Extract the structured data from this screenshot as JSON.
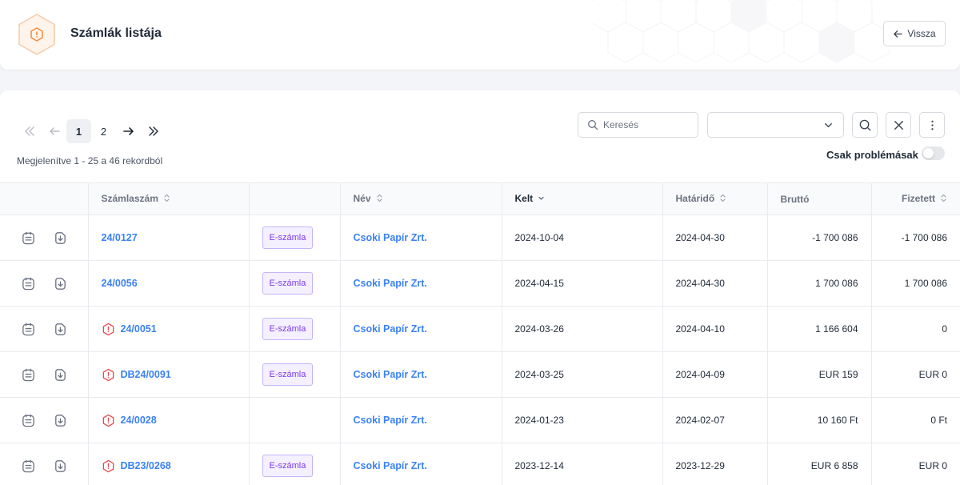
{
  "header": {
    "title": "Számlák listája",
    "back_label": "Vissza"
  },
  "pagination": {
    "pages": [
      "1",
      "2"
    ],
    "current": "1",
    "records_text": "Megjelenítve 1 - 25 a 46 rekordból"
  },
  "filters": {
    "search_placeholder": "Keresés",
    "select_value": "",
    "toggle_label": "Csak problémásak",
    "toggle_on": false
  },
  "table": {
    "columns": [
      "",
      "Számlaszám",
      "",
      "Név",
      "Kelt",
      "Határidő",
      "Bruttó",
      "Fizetett"
    ],
    "rows": [
      {
        "invoice": "24/0127",
        "warning": false,
        "badge": "E-számla",
        "name": "Csoki Papír Zrt.",
        "issued": "2024-10-04",
        "due": "2024-04-30",
        "gross": "-1 700 086",
        "paid": "-1 700 086"
      },
      {
        "invoice": "24/0056",
        "warning": false,
        "badge": "E-számla",
        "name": "Csoki Papír Zrt.",
        "issued": "2024-04-15",
        "due": "2024-04-30",
        "gross": "1 700 086",
        "paid": "1 700 086"
      },
      {
        "invoice": "24/0051",
        "warning": true,
        "badge": "E-számla",
        "name": "Csoki Papír Zrt.",
        "issued": "2024-03-26",
        "due": "2024-04-10",
        "gross": "1 166 604",
        "paid": "0"
      },
      {
        "invoice": "DB24/0091",
        "warning": true,
        "badge": "E-számla",
        "name": "Csoki Papír Zrt.",
        "issued": "2024-03-25",
        "due": "2024-04-09",
        "gross": "EUR 159",
        "paid": "EUR 0"
      },
      {
        "invoice": "24/0028",
        "warning": true,
        "badge": "",
        "name": "Csoki Papír Zrt.",
        "issued": "2024-01-23",
        "due": "2024-02-07",
        "gross": "10 160 Ft",
        "paid": "0 Ft"
      },
      {
        "invoice": "DB23/0268",
        "warning": true,
        "badge": "E-számla",
        "name": "Csoki Papír Zrt.",
        "issued": "2023-12-14",
        "due": "2023-12-29",
        "gross": "EUR 6 858",
        "paid": "EUR 0"
      }
    ]
  },
  "colors": {
    "accent": "#3b82f6",
    "warning": "#e5484d",
    "badge_text": "#7c3aed",
    "badge_border": "#c4b5fd",
    "header_badge": "#f9a56a"
  }
}
